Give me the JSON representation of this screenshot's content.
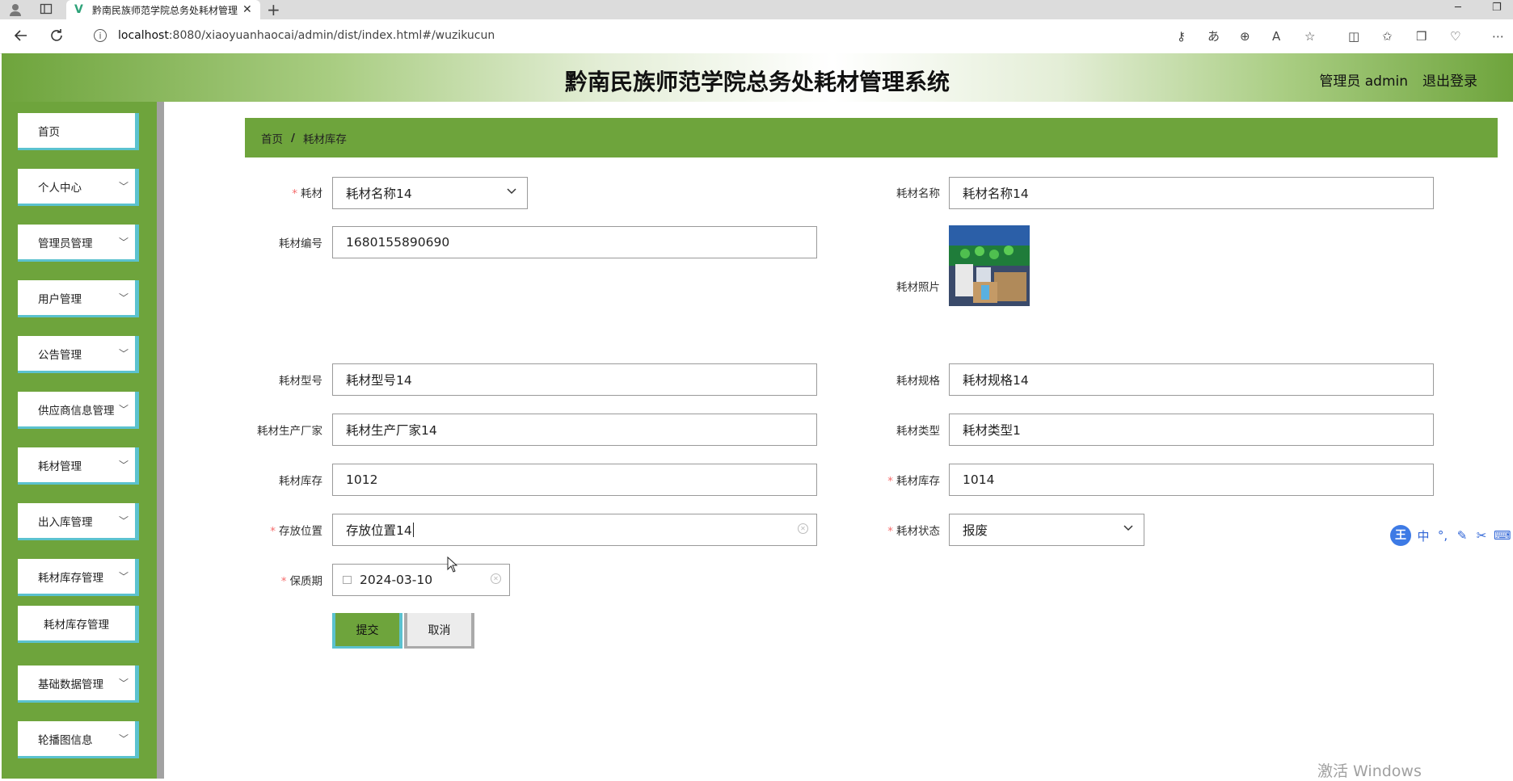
{
  "browser": {
    "tab_title": "黔南民族师范学院总务处耗材管理系统",
    "tab_close": "✕",
    "new_tab": "+",
    "url_host": "localhost",
    "url_rest": ":8080/xiaoyuanhaocai/admin/dist/index.html#/wuzikucun",
    "window_min": "─",
    "window_restore": "❐"
  },
  "header": {
    "title": "黔南民族师范学院总务处耗材管理系统",
    "user": "管理员 admin",
    "logout": "退出登录"
  },
  "sidebar": {
    "items": [
      {
        "label": "首页",
        "expandable": false
      },
      {
        "label": "个人中心",
        "expandable": true
      },
      {
        "label": "管理员管理",
        "expandable": true
      },
      {
        "label": "用户管理",
        "expandable": true
      },
      {
        "label": "公告管理",
        "expandable": true
      },
      {
        "label": "供应商信息管理",
        "expandable": true
      },
      {
        "label": "耗材管理",
        "expandable": true
      },
      {
        "label": "出入库管理",
        "expandable": true
      },
      {
        "label": "耗材库存管理",
        "expandable": true
      },
      {
        "label": "基础数据管理",
        "expandable": true
      },
      {
        "label": "轮播图信息",
        "expandable": true
      }
    ],
    "sub_item": "耗材库存管理"
  },
  "breadcrumb": {
    "home": "首页",
    "separator": "/",
    "current": "耗材库存"
  },
  "form": {
    "material_label": "耗材",
    "material_value": "耗材名称14",
    "name_label": "耗材名称",
    "name_value": "耗材名称14",
    "code_label": "耗材编号",
    "code_value": "1680155890690",
    "photo_label": "耗材照片",
    "model_label": "耗材型号",
    "model_value": "耗材型号14",
    "spec_label": "耗材规格",
    "spec_value": "耗材规格14",
    "maker_label": "耗材生产厂家",
    "maker_value": "耗材生产厂家14",
    "type_label": "耗材类型",
    "type_value": "耗材类型1",
    "stock_label": "耗材库存",
    "stock_value": "1012",
    "stock2_label": "耗材库存",
    "stock2_value": "1014",
    "location_label": "存放位置",
    "location_value": "存放位置14",
    "status_label": "耗材状态",
    "status_value": "报废",
    "expiry_label": "保质期",
    "expiry_value": "2024-03-10",
    "required_mark": "*",
    "submit": "提交",
    "cancel": "取消"
  },
  "ime": {
    "logo": "王",
    "lang": "中"
  },
  "watermark": "激活 Windows",
  "colors": {
    "brand_green": "#6ea43c",
    "accent_teal": "#5bc2cf",
    "required_red": "#f56c6c"
  }
}
